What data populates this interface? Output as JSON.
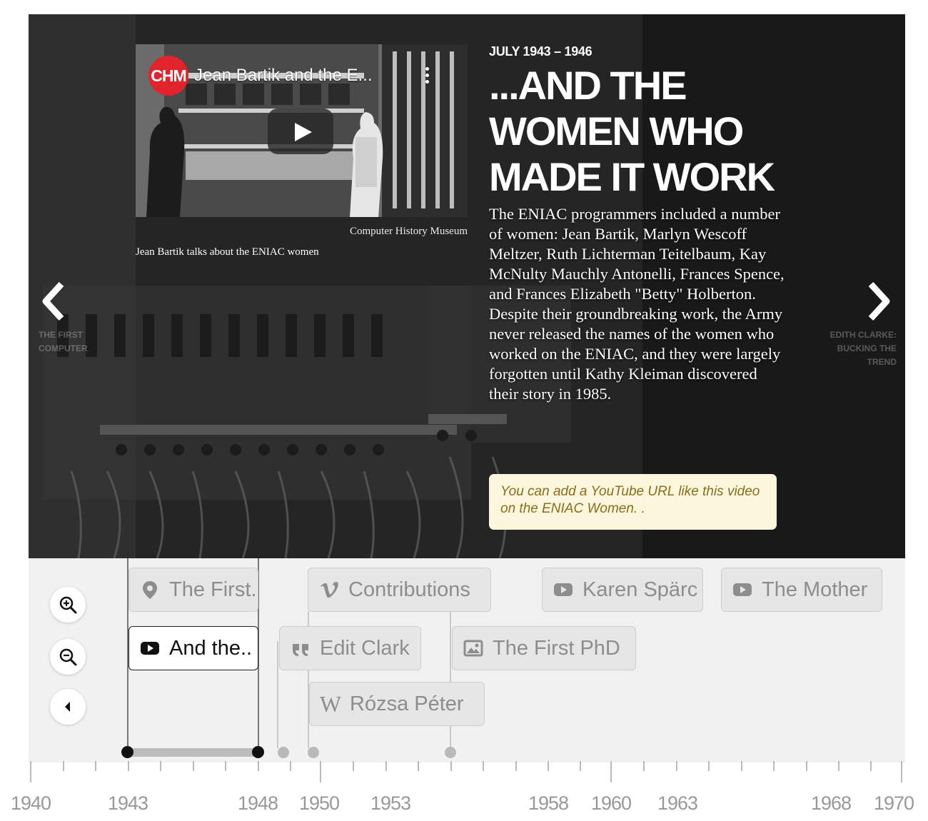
{
  "slide": {
    "date": "JULY 1943 – 1946",
    "headline": "...AND THE WOMEN WHO MADE IT WORK",
    "body": "The ENIAC programmers included a number of women: Jean Bartik, Marlyn Wescoff Meltzer, Ruth Lichterman Teitelbaum, Kay McNulty Mauchly Antonelli, Frances Spence, and Frances Elizabeth \"Betty\" Holberton. Despite their groundbreaking work, the Army never released the names of the women who worked on the ENIAC, and they were largely forgotten until Kathy Kleiman discovered their story in 1985.",
    "tip": "You can add a YouTube URL like this video on the ENIAC Women. .",
    "media": {
      "channel_logo": "CHM",
      "video_title": "Jean Bartik and the E...",
      "credit": "Computer History Museum",
      "caption": "Jean Bartik talks about the ENIAC women"
    },
    "nav_prev": {
      "icon": "chevron-left-icon",
      "caption": "THE FIRST COMPUTER"
    },
    "nav_next": {
      "icon": "chevron-right-icon",
      "caption": "EDITH CLARKE: BUCKING THE TREND"
    }
  },
  "timenav": {
    "controls": [
      {
        "name": "zoom-in-button",
        "icon": "zoom-in-icon"
      },
      {
        "name": "zoom-out-button",
        "icon": "zoom-out-icon"
      },
      {
        "name": "back-to-start-button",
        "icon": "caret-left-icon"
      }
    ],
    "markers": [
      {
        "label": "The First..",
        "icon": "map-pin-icon",
        "active": false
      },
      {
        "label": "And the..",
        "icon": "youtube-icon",
        "active": true
      },
      {
        "label": "Contributions",
        "icon": "vimeo-icon",
        "active": false
      },
      {
        "label": "Edit Clark",
        "icon": "quote-icon",
        "active": false
      },
      {
        "label": "Rózsa Péter",
        "icon": "wikipedia-icon",
        "active": false
      },
      {
        "label": "Karen Spärc",
        "icon": "youtube-icon",
        "active": false
      },
      {
        "label": "The First PhD",
        "icon": "image-icon",
        "active": false
      },
      {
        "label": "The Mother",
        "icon": "youtube-icon",
        "active": false
      }
    ],
    "axis_labels": [
      "1940",
      "1943",
      "1948",
      "1950",
      "1953",
      "1958",
      "1960",
      "1963",
      "1968",
      "1970"
    ]
  },
  "colors": {
    "tip_background": "#fcf6dc",
    "tip_text": "#8a6d1e",
    "chm_red": "#e1242c",
    "timenav_background": "#f1f1f1"
  }
}
